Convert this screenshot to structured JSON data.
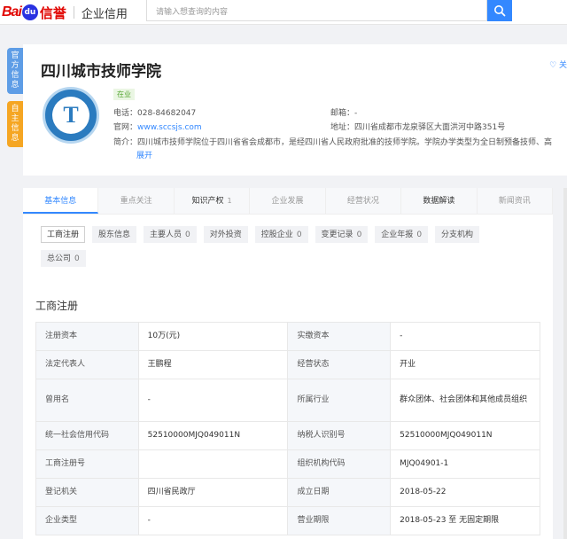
{
  "header": {
    "logo_bai": "Bai",
    "logo_du": "du",
    "logo_xy": "信誉",
    "logo_service": "企业信用",
    "search_placeholder": "请输入想查询的内容"
  },
  "side_tabs": [
    "官方信息",
    "自主信息"
  ],
  "company": {
    "name": "四川城市技师学院",
    "follow": "♡ 关",
    "status": "在业",
    "emblem_letter": "T",
    "phone_label": "电话：",
    "phone": "028-84682047",
    "website_label": "官网：",
    "website": "www.sccsjs.com",
    "intro_label": "简介：",
    "intro": "四川城市技师学院位于四川省省会成都市，是经四川省人民政府批准的技师学院。学院办学类型为全日制预备技师、高",
    "email_label": "邮箱：",
    "email": "-",
    "address_label": "地址：",
    "address": "四川省成都市龙泉驿区大面洪河中路351号",
    "expand": "展开"
  },
  "tabs": [
    {
      "label": "基本信息",
      "count": "",
      "state": "active"
    },
    {
      "label": "重点关注",
      "count": "",
      "state": "muted"
    },
    {
      "label": "知识产权",
      "count": "1",
      "state": "dark"
    },
    {
      "label": "企业发展",
      "count": "",
      "state": "muted"
    },
    {
      "label": "经营状况",
      "count": "",
      "state": "muted"
    },
    {
      "label": "数据解读",
      "count": "",
      "state": "dark"
    },
    {
      "label": "新闻资讯",
      "count": "",
      "state": "muted"
    }
  ],
  "chips": [
    {
      "label": "工商注册",
      "count": "",
      "active": true
    },
    {
      "label": "股东信息",
      "count": "",
      "active": false
    },
    {
      "label": "主要人员",
      "count": "0",
      "active": false
    },
    {
      "label": "对外投资",
      "count": "",
      "active": false
    },
    {
      "label": "控股企业",
      "count": "0",
      "active": false
    },
    {
      "label": "变更记录",
      "count": "0",
      "active": false
    },
    {
      "label": "企业年报",
      "count": "0",
      "active": false
    },
    {
      "label": "分支机构",
      "count": "",
      "active": false
    },
    {
      "label": "总公司",
      "count": "0",
      "active": false
    }
  ],
  "section_title": "工商注册",
  "registration": [
    {
      "l1": "注册资本",
      "v1": "10万(元)",
      "l2": "实缴资本",
      "v2": "-"
    },
    {
      "l1": "法定代表人",
      "v1": "王鹏程",
      "l2": "经营状态",
      "v2": "开业"
    },
    {
      "l1": "曾用名",
      "v1": "-",
      "l2": "所属行业",
      "v2": "群众团体、社会团体和其他成员组织"
    },
    {
      "l1": "统一社会信用代码",
      "v1": "52510000MJQ049011N",
      "l2": "纳税人识别号",
      "v2": "52510000MJQ049011N"
    },
    {
      "l1": "工商注册号",
      "v1": "",
      "l2": "组织机构代码",
      "v2": "MJQ04901-1"
    },
    {
      "l1": "登记机关",
      "v1": "四川省民政厅",
      "l2": "成立日期",
      "v2": "2018-05-22"
    },
    {
      "l1": "企业类型",
      "v1": "-",
      "l2": "营业期限",
      "v2": "2018-05-23 至 无固定期限"
    }
  ]
}
